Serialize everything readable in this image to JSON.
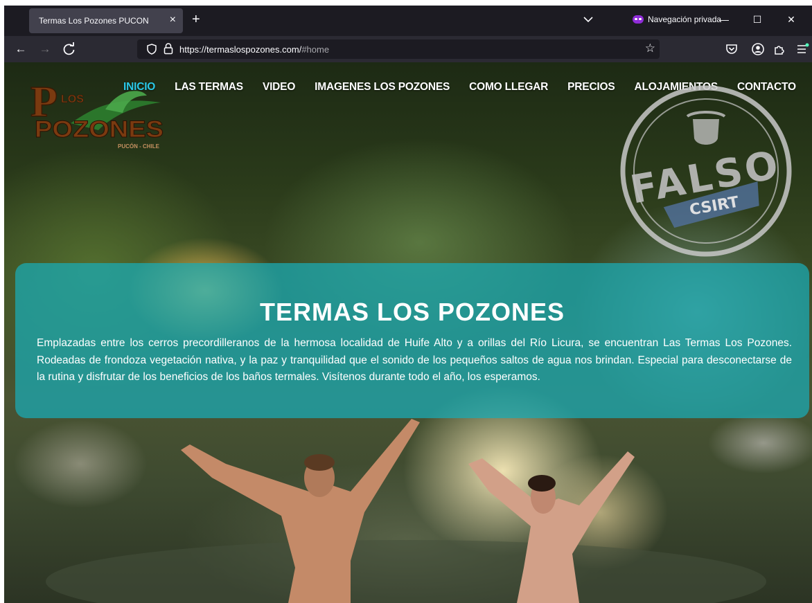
{
  "browser": {
    "tab_title": "Termas Los Pozones PUCON",
    "tab_close": "×",
    "new_tab": "+",
    "private_label": "Navegación privada",
    "url_host": "https://termaslospozones.com/",
    "url_fragment": "#home",
    "minimize": "—",
    "maximize": "☐",
    "close": "✕"
  },
  "logo": {
    "los": "LOS",
    "pozones": "POZONES",
    "location": "PUCÓN - CHILE"
  },
  "menu": {
    "items": [
      "INICIO",
      "LAS TERMAS",
      "VIDEO",
      "IMAGENES LOS POZONES",
      "COMO LLEGAR",
      "PRECIOS",
      "ALOJAMIENTOS",
      "CONTACTO"
    ],
    "active_index": 0,
    "active_color": "#2ac9e8"
  },
  "stamp": {
    "word": "FALSO",
    "org": "CSIRT"
  },
  "banner": {
    "title": "TERMAS LOS POZONES",
    "text": "Emplazadas entre los cerros precordilleranos de la hermosa localidad de Huife Alto y a orillas del Río Licura, se encuentran Las Termas Los Pozones. Rodeadas de frondoza vegetación nativa, y la paz y tranquilidad que el sonido de los pequeños saltos de agua nos brindan. Especial para desconectarse de la rutina y  disfrutar de los beneficios de los baños termales. Visítenos durante todo el año, los esperamos.",
    "color": "#19aab4"
  }
}
